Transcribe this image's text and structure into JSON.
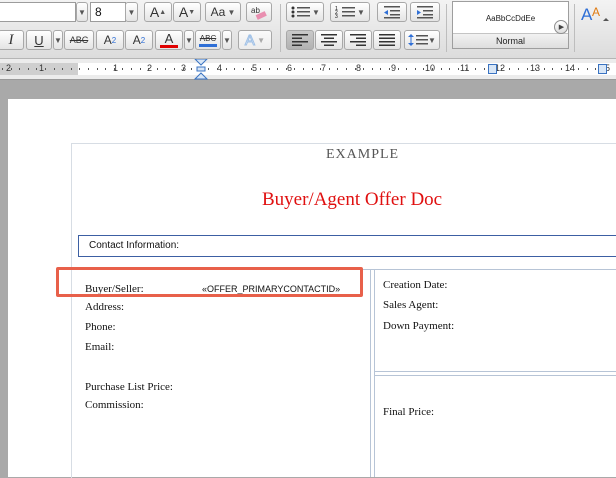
{
  "toolbar": {
    "font_size": "8",
    "grow_font": "A",
    "shrink_font": "A",
    "change_case": "Aa",
    "italic": "I",
    "underline": "U",
    "strikethrough": "ABC",
    "superscript_base": "A",
    "superscript_mark": "2",
    "subscript_base": "A",
    "subscript_mark": "2",
    "font_color": "A",
    "highlight": "ABC",
    "text_effects": "A",
    "font_color_hex": "#e00000",
    "highlight_hex": "#2f6fd6"
  },
  "styles": {
    "preview": "AaBbCcDdEe",
    "name": "Normal"
  },
  "ruler": {
    "labels": [
      "2",
      "1",
      "1",
      "2",
      "3",
      "4",
      "5",
      "6",
      "7",
      "8",
      "9",
      "10",
      "11",
      "12",
      "13",
      "14",
      "15",
      "16"
    ]
  },
  "document": {
    "heading": "EXAMPLE",
    "title": "Buyer/Agent Offer Doc",
    "title_color": "#e01010",
    "section_label": "Contact Information:",
    "left_fields": {
      "buyer_label": "Buyer/Seller:",
      "buyer_value": "«OFFER_PRIMARYCONTACTID»",
      "address": "Address:",
      "phone": "Phone:",
      "email": "Email:",
      "purchase_list_price": "Purchase List Price:",
      "commission": "Commission:"
    },
    "right_fields": {
      "creation_date": "Creation Date:",
      "sales_agent": "Sales Agent:",
      "down_payment": "Down Payment:",
      "final_price": "Final Price:"
    },
    "highlight_color": "#e8604a"
  }
}
